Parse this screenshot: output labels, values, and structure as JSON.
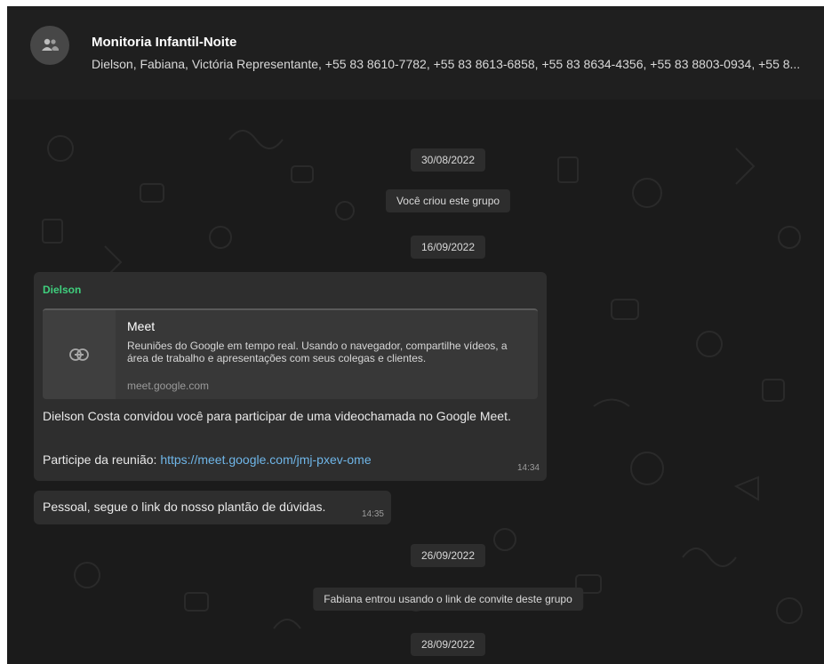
{
  "header": {
    "avatar_icon": "group-icon",
    "title": "Monitoria Infantil-Noite",
    "members": "Dielson, Fabiana, Victória Representante, +55 83 8610-7782, +55 83 8613-6858, +55 83 8634-4356, +55 83 8803-0934, +55 8..."
  },
  "timeline": {
    "date1": "30/08/2022",
    "system1": "Você criou este grupo",
    "date2": "16/09/2022",
    "date3": "26/09/2022",
    "system2": "Fabiana entrou usando o link de convite deste grupo",
    "date4": "28/09/2022"
  },
  "messages": [
    {
      "sender": "Dielson",
      "preview": {
        "icon": "link-icon",
        "title": "Meet",
        "description": "Reuniões do Google em tempo real. Usando o navegador, compartilhe vídeos, a área de trabalho e apresentações com seus colegas e clientes.",
        "domain": "meet.google.com"
      },
      "text": "Dielson Costa convidou você para participar de uma videochamada no Google Meet.",
      "join_label": "Participe da reunião: ",
      "join_url": "https://meet.google.com/jmj-pxev-ome",
      "time": "14:34"
    },
    {
      "text": "Pessoal, segue o link do nosso plantão de dúvidas.",
      "time": "14:35"
    }
  ],
  "colors": {
    "background": "#1b1b1b",
    "bubble": "#2e2e2e",
    "sender": "#3fcf7d",
    "link": "#6fb6e8"
  }
}
